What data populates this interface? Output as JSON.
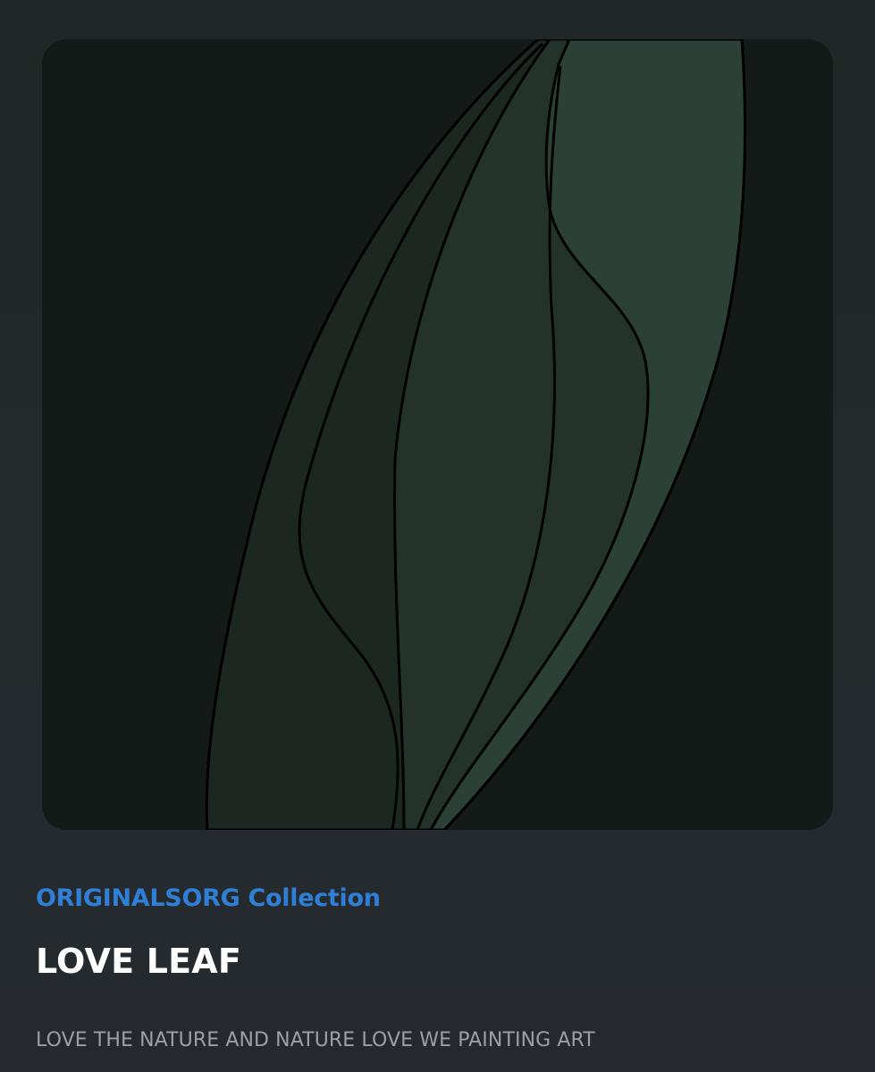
{
  "nft": {
    "collection_name": "ORIGINALSORG Collection",
    "title": "LOVE LEAF",
    "description": "LOVE THE NATURE AND NATURE LOVE WE PAINTING ART"
  },
  "artwork": {
    "subject": "leaf",
    "colors": {
      "background": "#131a17",
      "leaf_dark": "#1c2721",
      "leaf_mid": "#23332c",
      "leaf_light": "#2b4037",
      "outline": "#000000"
    }
  },
  "theme": {
    "accent": "#2f7fd6",
    "title_color": "#ffffff",
    "description_color": "#9aa0a6"
  }
}
